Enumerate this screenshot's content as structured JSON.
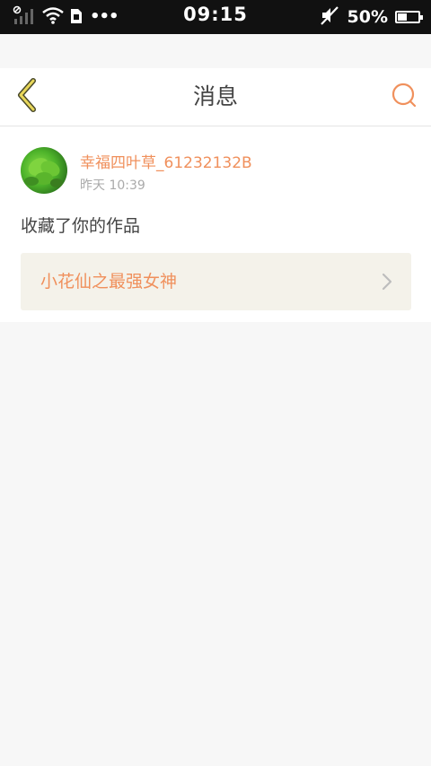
{
  "status_bar": {
    "time": "09:15",
    "battery_text": "50%",
    "battery_level": 0.5,
    "icons": [
      "signal-icon",
      "wifi-icon",
      "sim-icon",
      "more-dots-icon",
      "mute-icon",
      "battery-icon"
    ]
  },
  "nav": {
    "title": "消息",
    "back_icon": "chevron-left-icon",
    "search_icon": "search-icon"
  },
  "message": {
    "username": "幸福四叶草_61232132B",
    "timestamp": "昨天 10:39",
    "action": "收藏了你的作品",
    "work_title": "小花仙之最强女神"
  },
  "colors": {
    "accent": "#f0905c",
    "back_icon": "#c9b63a",
    "card_bg": "#f4f2ea",
    "page_bg": "#f7f7f7",
    "status_bar_bg": "#111111"
  }
}
